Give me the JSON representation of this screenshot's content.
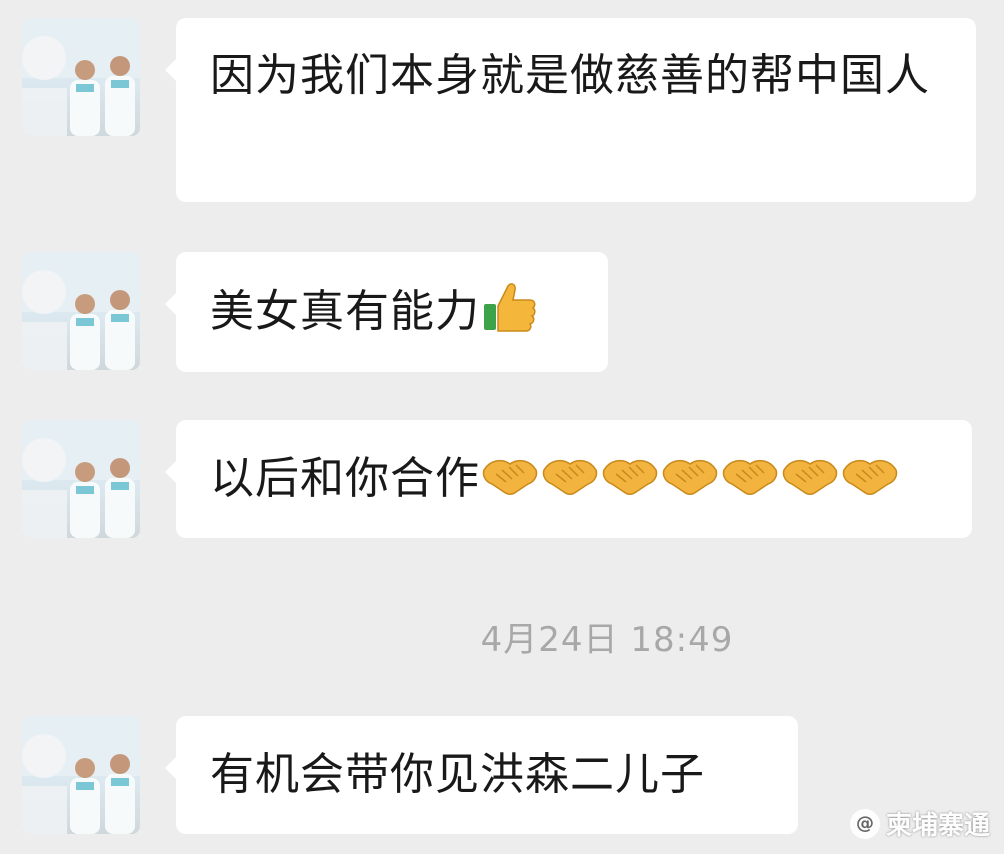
{
  "messages": [
    {
      "text": "因为我们本身就是做慈善的帮中国人",
      "emojis": []
    },
    {
      "text": "美女真有能力",
      "emojis": [
        "thumbs-up"
      ]
    },
    {
      "text": "以后和你合作",
      "emojis": [
        "handshake",
        "handshake",
        "handshake",
        "handshake",
        "handshake",
        "handshake",
        "handshake"
      ]
    },
    {
      "text": "有机会带你见洪森二儿子",
      "emojis": []
    }
  ],
  "timestamp": "4月24日 18:49",
  "watermark": {
    "text": "柬埔寨通"
  },
  "colors": {
    "background": "#ededed",
    "bubble": "#ffffff",
    "timestamp": "#a8a8a8",
    "text": "#191919"
  }
}
